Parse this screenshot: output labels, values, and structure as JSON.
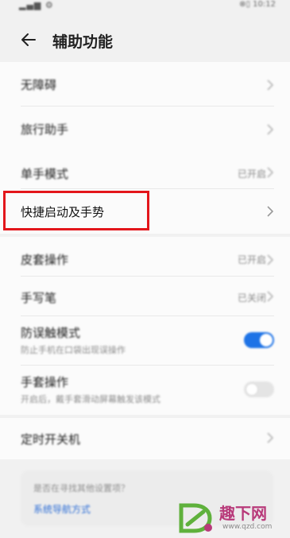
{
  "status": {
    "left": "▂▄▆ ⚙",
    "right": "⊗▯ 10:12"
  },
  "header": {
    "title": "辅助功能"
  },
  "rows": [
    {
      "label": "无障碍"
    },
    {
      "label": "旅行助手"
    },
    {
      "label": "单手模式",
      "value": "已开启"
    },
    {
      "label": "快捷启动及手势"
    },
    {
      "label": "皮套操作",
      "value": "已开启"
    },
    {
      "label": "手写笔",
      "value": "已关闭"
    },
    {
      "label": "防误触模式",
      "sub": "防止手机在口袋出现误操作",
      "toggle": true
    },
    {
      "label": "手套操作",
      "sub": "开启后，戴手套滑动屏幕触发该模式",
      "toggle": false
    },
    {
      "label": "定时开关机"
    }
  ],
  "suggestion": {
    "question": "是否在寻找其他设置项？",
    "link": "系统导航方式"
  },
  "watermark": {
    "brand": "趣下网",
    "url": "www.qzd.com"
  },
  "colors": {
    "highlight": "#e3161b",
    "toggle_on": "#1e73e6",
    "link": "#2f6fd6",
    "watermark": "#b83a7a"
  }
}
